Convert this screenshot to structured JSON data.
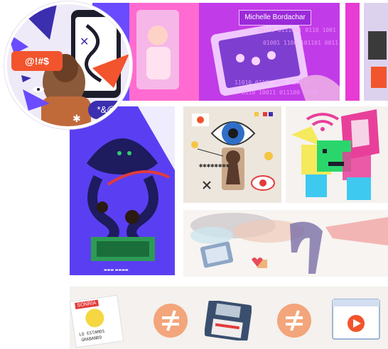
{
  "banner": {
    "name_label": "Michelle Bordachar",
    "binary_lines": [
      "10110 0111001 0110 1001",
      "01001 1100 101101 0011",
      "11010 0110 1001 110110",
      "0110 10011 011100 1010"
    ]
  },
  "badge": {
    "symbols": "@!#$",
    "symbols_2": "*&@"
  },
  "sticker": {
    "line1": "SONRÍA",
    "line2": "LO ESTAMOS",
    "line3": "GRABANDO"
  },
  "colors": {
    "banner_magenta": "#b52ee6",
    "tile_purple": "#5a3ff2",
    "accent_orange": "#f2542d",
    "accent_pink": "#e83bd3"
  }
}
